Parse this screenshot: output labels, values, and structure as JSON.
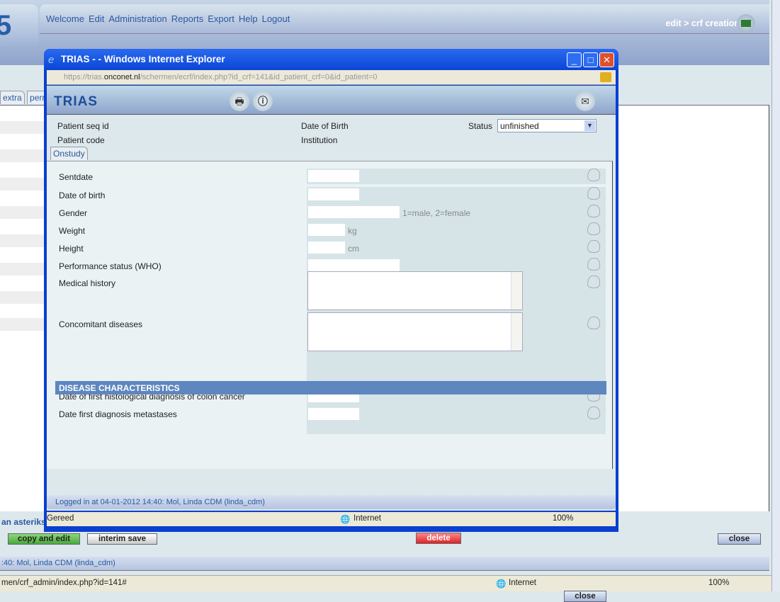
{
  "app": {
    "menu": [
      "Welcome",
      "Edit",
      "Administration",
      "Reports",
      "Export",
      "Help",
      "Logout"
    ],
    "breadcrumb": "edit > crf creation",
    "tabs": [
      "extra",
      "perm"
    ],
    "asterisk_text": "an asteriks",
    "buttons": {
      "copy_edit": "copy and edit",
      "interim_save": "interim save",
      "delete": "delete",
      "close": "close"
    },
    "buttons_colors": {
      "copy_edit": "#5cb84a",
      "delete": "#e0382c"
    },
    "footer": ":40: Mol, Linda CDM (linda_cdm)",
    "status_url": "men/crf_admin/index.php?id=141#",
    "status_zone": "Internet",
    "zoom": "100%"
  },
  "popup": {
    "title": "TRIAS - - Windows Internet Explorer",
    "url_pre": "https://trias.",
    "url_host": "onconet.nl",
    "url_rest": "/schermen/ecrf/index.php?id_crf=141&id_patient_crf=0&id_patient=0",
    "logo": "TRIAS",
    "info": {
      "seq": "Patient seq id",
      "code": "Patient code",
      "dob": "Date of Birth",
      "inst": "Institution",
      "status_label": "Status",
      "status_value": "unfinished"
    },
    "tab": "Onstudy",
    "fields": [
      {
        "label": "Sentdate",
        "w": 72
      },
      {
        "label": "Date of birth",
        "w": 72
      },
      {
        "label": "Gender",
        "w": 129,
        "unit": "1=male, 2=female"
      },
      {
        "label": "Weight",
        "w": 52,
        "unit": "kg"
      },
      {
        "label": "Height",
        "w": 52,
        "unit": "cm"
      },
      {
        "label": "Performance status (WHO)",
        "w": 129
      }
    ],
    "textareas": [
      "Medical history",
      "Concomitant diseases"
    ],
    "section": "DISEASE CHARACTERISTICS",
    "section_fields": [
      "Date of first histological diagnosis of colon cancer",
      "Date first diagnosis metastases"
    ],
    "close": "close",
    "logged": "Logged in at 04-01-2012 14:40: Mol, Linda CDM (linda_cdm)",
    "status": "Gereed",
    "zone": "Internet",
    "zoom": "100%"
  }
}
